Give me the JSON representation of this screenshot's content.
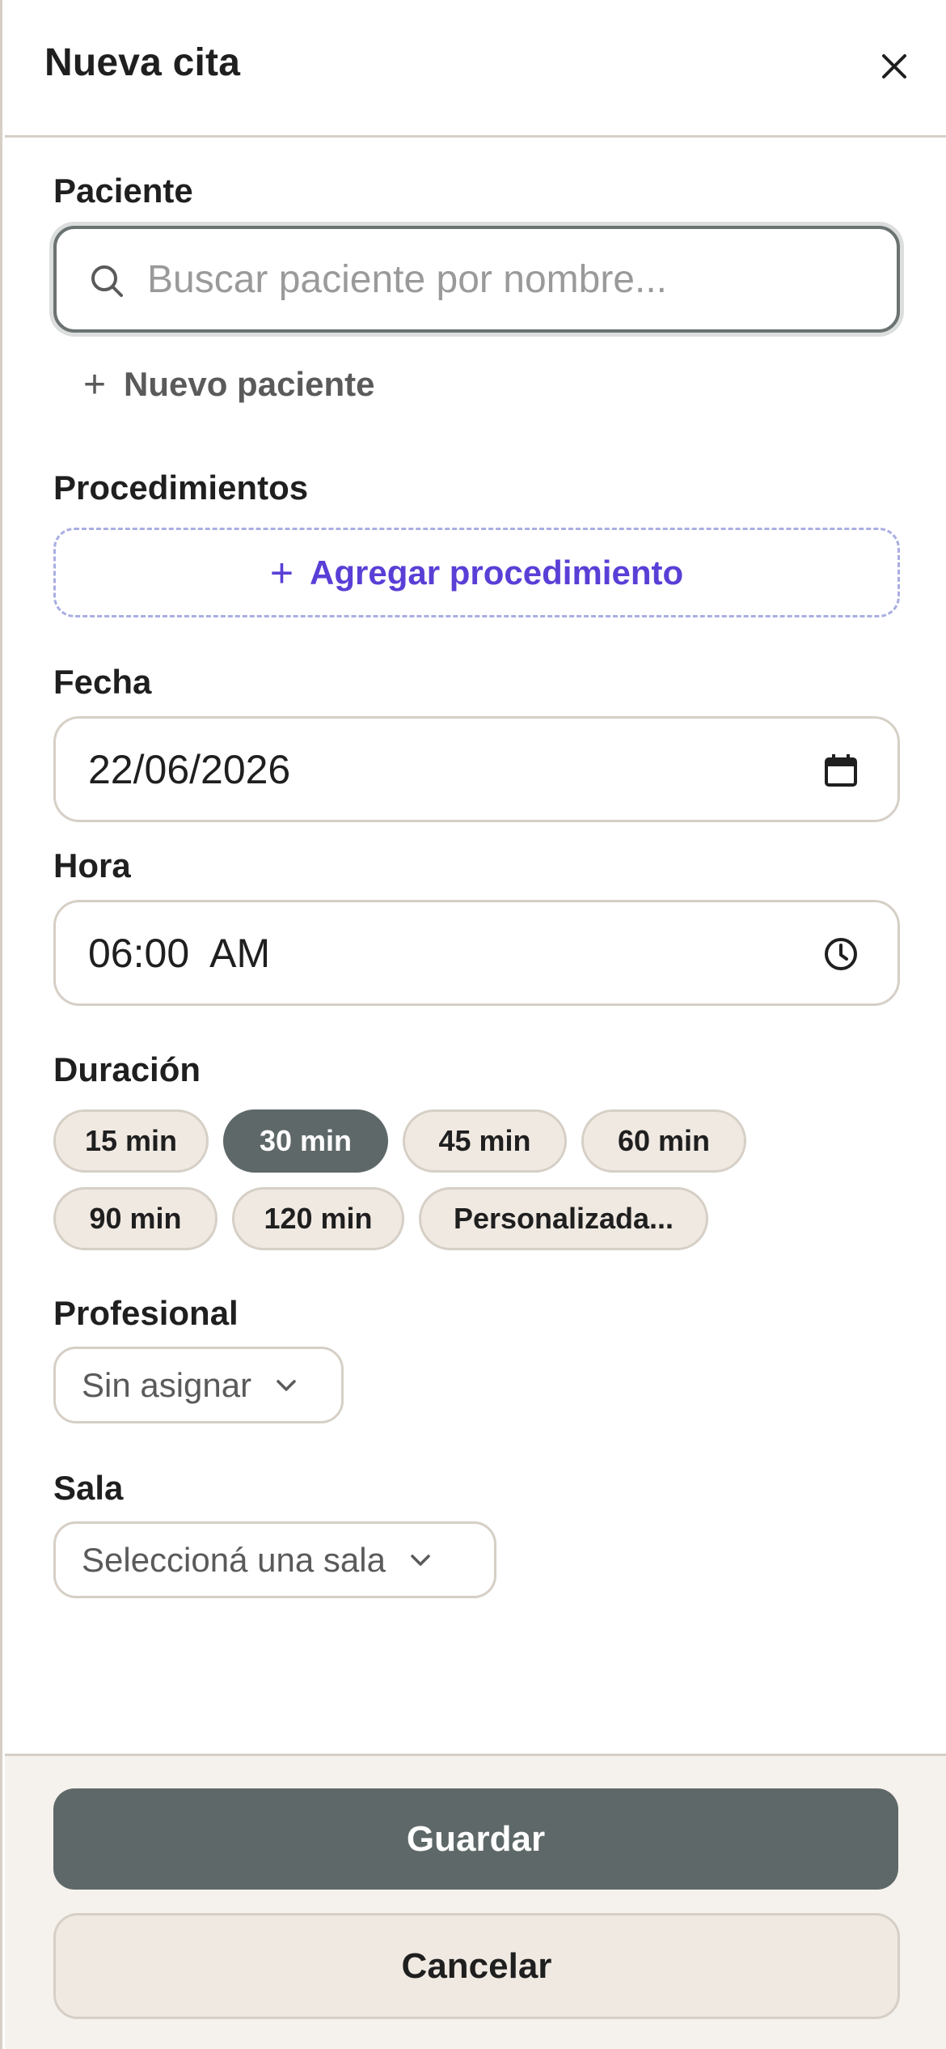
{
  "header": {
    "title": "Nueva cita"
  },
  "patient": {
    "label": "Paciente",
    "search_placeholder": "Buscar paciente por nombre...",
    "search_value": "",
    "new_patient_label": "Nuevo paciente"
  },
  "procedures": {
    "label": "Procedimientos",
    "add_label": "Agregar procedimiento"
  },
  "date": {
    "label": "Fecha",
    "value": "22/06/2026"
  },
  "time": {
    "label": "Hora",
    "value": "06:00  AM"
  },
  "duration": {
    "label": "Duración",
    "options": [
      "15 min",
      "30 min",
      "45 min",
      "60 min",
      "90 min",
      "120 min",
      "Personalizada..."
    ],
    "selected": "30 min"
  },
  "professional": {
    "label": "Profesional",
    "value": "Sin asignar"
  },
  "room": {
    "label": "Sala",
    "value": "Seleccioná una sala"
  },
  "footer": {
    "save_label": "Guardar",
    "cancel_label": "Cancelar"
  },
  "colors": {
    "accent": "#5a3fd6",
    "primary_button": "#5f6868",
    "chip_background": "#efe9e2",
    "border": "#d6cfc6"
  }
}
